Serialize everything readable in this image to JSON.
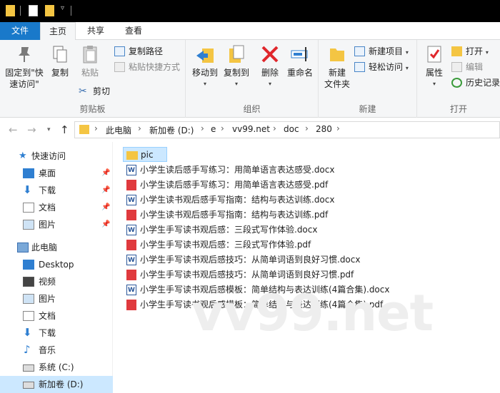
{
  "ribbon_tabs": {
    "file": "文件",
    "home": "主页",
    "share": "共享",
    "view": "查看"
  },
  "clipboard": {
    "pin_label": "固定到\"快速访问\"",
    "copy_label": "复制",
    "paste_label": "粘贴",
    "copy_path": "复制路径",
    "paste_shortcut": "粘贴快捷方式",
    "cut": "剪切",
    "group_label": "剪贴板"
  },
  "organize": {
    "move_to": "移动到",
    "copy_to": "复制到",
    "delete": "删除",
    "rename": "重命名",
    "group_label": "组织"
  },
  "new": {
    "new_folder": "新建\n文件夹",
    "new_item": "新建项目",
    "easy_access": "轻松访问",
    "group_label": "新建"
  },
  "open": {
    "properties": "属性",
    "open": "打开",
    "edit": "编辑",
    "history": "历史记录",
    "group_label": "打开"
  },
  "address": {
    "crumbs": [
      "此电脑",
      "新加卷 (D:)",
      "e",
      "vv99.net",
      "doc",
      "280"
    ]
  },
  "nav": {
    "quick_access": "快速访问",
    "quick_items": [
      "桌面",
      "下载",
      "文档",
      "图片"
    ],
    "this_pc": "此电脑",
    "pc_items": [
      "Desktop",
      "视频",
      "图片",
      "文档",
      "下载",
      "音乐",
      "系统 (C:)",
      "新加卷 (D:)"
    ]
  },
  "files": [
    {
      "name": "pic",
      "type": "folder"
    },
    {
      "name": "小学生读后感手写练习：用简单语言表达感受.docx",
      "type": "docx"
    },
    {
      "name": "小学生读后感手写练习：用简单语言表达感受.pdf",
      "type": "pdf"
    },
    {
      "name": "小学生读书观后感手写指南：结构与表达训练.docx",
      "type": "docx"
    },
    {
      "name": "小学生读书观后感手写指南：结构与表达训练.pdf",
      "type": "pdf"
    },
    {
      "name": "小学生手写读书观后感：三段式写作体验.docx",
      "type": "docx"
    },
    {
      "name": "小学生手写读书观后感：三段式写作体验.pdf",
      "type": "pdf"
    },
    {
      "name": "小学生手写读书观后感技巧：从简单词语到良好习惯.docx",
      "type": "docx"
    },
    {
      "name": "小学生手写读书观后感技巧：从简单词语到良好习惯.pdf",
      "type": "pdf"
    },
    {
      "name": "小学生手写读书观后感模板：简单结构与表达训练(4篇合集).docx",
      "type": "docx"
    },
    {
      "name": "小学生手写读书观后感模板：简单结构与表达训练(4篇合集).pdf",
      "type": "pdf"
    }
  ],
  "watermark": "vv99.net",
  "colors": {
    "accent": "#1979ca",
    "selection": "#cce8ff",
    "folder": "#f4c543",
    "pdf": "#e03a3e",
    "word": "#2b579a"
  }
}
